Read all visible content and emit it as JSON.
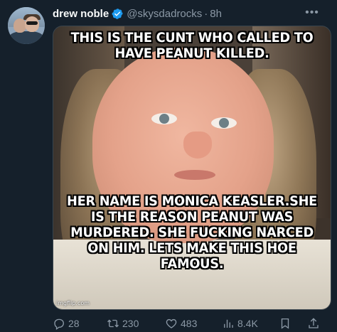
{
  "post": {
    "author": {
      "display_name": "drew noble",
      "handle": "@skysdadrocks",
      "separator": "·",
      "time": "8h"
    },
    "media": {
      "top_text": "THIS IS THE CUNT WHO CALLED TO HAVE PEANUT KILLED.",
      "bottom_text": "HER NAME IS MONICA KEASLER.SHE IS THE REASON PEANUT WAS MURDERED. SHE FUCKING NARCED ON HIM. LETS MAKE THIS HOE FAMOUS.",
      "watermark": "imgflip.com"
    },
    "actions": {
      "replies": "28",
      "reposts": "230",
      "likes": "483",
      "views": "8.4K"
    }
  },
  "colors": {
    "background": "#15202b",
    "muted_text": "#8b98a5",
    "verified": "#1d9bf0"
  },
  "icons": [
    "verified-badge-icon",
    "more-icon",
    "reply-icon",
    "repost-icon",
    "like-icon",
    "views-icon",
    "bookmark-icon",
    "share-icon"
  ]
}
